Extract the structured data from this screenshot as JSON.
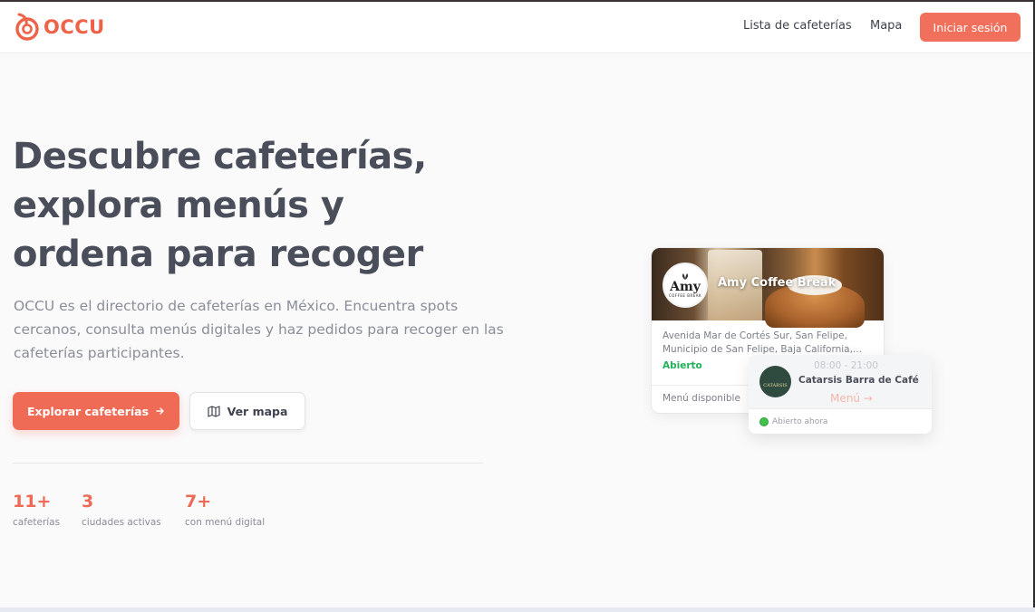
{
  "brand": {
    "name": "OCCU",
    "color": "#ee6347"
  },
  "nav": {
    "links": [
      "Lista de cafeterías",
      "Mapa"
    ],
    "login_label": "Iniciar sesión"
  },
  "hero": {
    "title_lines": [
      "Descubre cafeterías,",
      "explora menús y",
      "ordena para recoger"
    ],
    "description": "OCCU es el directorio de cafeterías en México. Encuentra spots cercanos, consulta menús digitales y haz pedidos para recoger en las cafeterías participantes.",
    "explore_label": "Explorar cafeterías",
    "explore_icon": "arrow-right-icon",
    "map_label": "Ver mapa",
    "map_icon": "map-icon"
  },
  "stats": [
    {
      "value": "11+",
      "label": "cafeterías"
    },
    {
      "value": "3",
      "label": "ciudades activas"
    },
    {
      "value": "7+",
      "label": "con menú digital"
    }
  ],
  "cards": {
    "primary": {
      "logo_text": "Amy",
      "logo_subtext": "COFFEE BREAK",
      "name": "Amy Coffee Break",
      "address": "Avenida Mar de Cortés Sur, San Felipe, Municipio de San Felipe, Baja California,...",
      "status": "Abierto",
      "menu_label": "Menú disponible"
    },
    "secondary": {
      "hours": "08:00 - 21:00",
      "logo_text": "CATARSIS",
      "name": "Catarsis Barra de Café",
      "menu_link": "Menú →",
      "status": "Abierto ahora"
    }
  },
  "colors": {
    "accent": "#ef6b56",
    "open": "#22b15a"
  }
}
